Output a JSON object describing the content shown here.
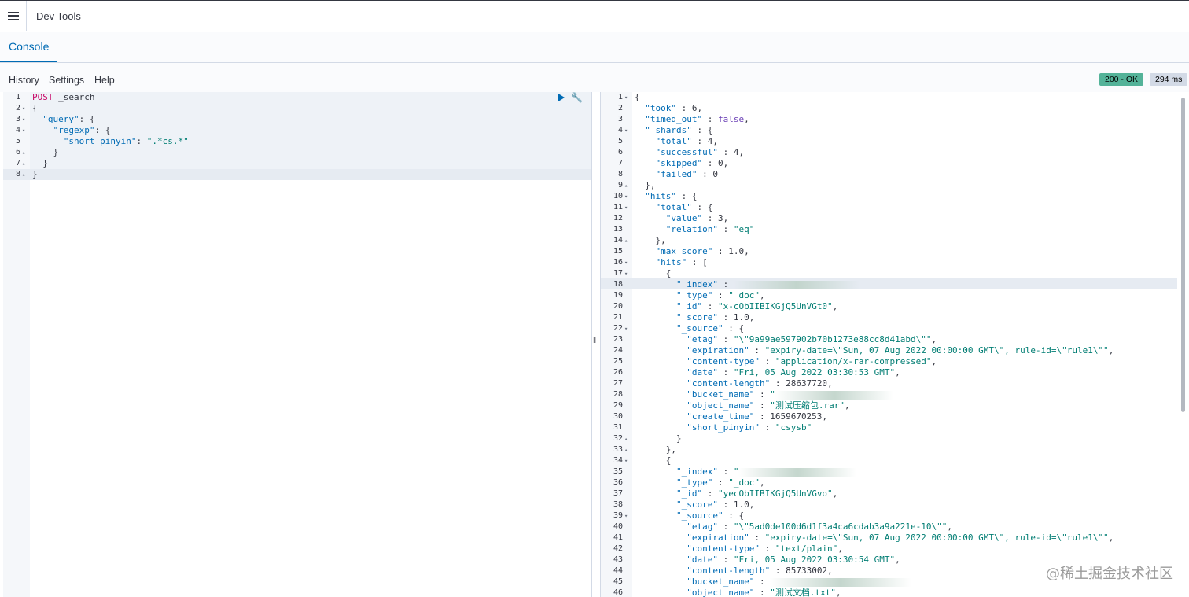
{
  "header": {
    "title": "Dev Tools"
  },
  "tabs": [
    {
      "label": "Console"
    }
  ],
  "toolbar": {
    "history": "History",
    "settings": "Settings",
    "help": "Help"
  },
  "status": {
    "code": "200 - OK",
    "time": "294 ms"
  },
  "request": {
    "lines": [
      {
        "num": "1",
        "fold": "",
        "parts": [
          [
            "method",
            "POST"
          ],
          [
            "url",
            " _search"
          ]
        ]
      },
      {
        "num": "2",
        "fold": "▾",
        "parts": [
          [
            "plain",
            "{"
          ]
        ]
      },
      {
        "num": "3",
        "fold": "▾",
        "parts": [
          [
            "plain",
            "  "
          ],
          [
            "key",
            "\"query\""
          ],
          [
            "plain",
            ": {"
          ]
        ]
      },
      {
        "num": "4",
        "fold": "▾",
        "parts": [
          [
            "plain",
            "    "
          ],
          [
            "key",
            "\"regexp\""
          ],
          [
            "plain",
            ": {"
          ]
        ]
      },
      {
        "num": "5",
        "fold": "",
        "parts": [
          [
            "plain",
            "      "
          ],
          [
            "key",
            "\"short_pinyin\""
          ],
          [
            "plain",
            ": "
          ],
          [
            "str",
            "\".*cs.*\""
          ]
        ]
      },
      {
        "num": "6",
        "fold": "▴",
        "parts": [
          [
            "plain",
            "    }"
          ]
        ]
      },
      {
        "num": "7",
        "fold": "▴",
        "parts": [
          [
            "plain",
            "  }"
          ]
        ]
      },
      {
        "num": "8",
        "fold": "▴",
        "parts": [
          [
            "plain",
            "}"
          ]
        ]
      }
    ]
  },
  "response": {
    "lines": [
      {
        "num": "1",
        "fold": "▾",
        "parts": [
          [
            "plain",
            "{"
          ]
        ]
      },
      {
        "num": "2",
        "fold": "",
        "parts": [
          [
            "plain",
            "  "
          ],
          [
            "key",
            "\"took\""
          ],
          [
            "plain",
            " : "
          ],
          [
            "num",
            "6"
          ],
          [
            "plain",
            ","
          ]
        ]
      },
      {
        "num": "3",
        "fold": "",
        "parts": [
          [
            "plain",
            "  "
          ],
          [
            "key",
            "\"timed_out\""
          ],
          [
            "plain",
            " : "
          ],
          [
            "bool",
            "false"
          ],
          [
            "plain",
            ","
          ]
        ]
      },
      {
        "num": "4",
        "fold": "▾",
        "parts": [
          [
            "plain",
            "  "
          ],
          [
            "key",
            "\"_shards\""
          ],
          [
            "plain",
            " : {"
          ]
        ]
      },
      {
        "num": "5",
        "fold": "",
        "parts": [
          [
            "plain",
            "    "
          ],
          [
            "key",
            "\"total\""
          ],
          [
            "plain",
            " : "
          ],
          [
            "num",
            "4"
          ],
          [
            "plain",
            ","
          ]
        ]
      },
      {
        "num": "6",
        "fold": "",
        "parts": [
          [
            "plain",
            "    "
          ],
          [
            "key",
            "\"successful\""
          ],
          [
            "plain",
            " : "
          ],
          [
            "num",
            "4"
          ],
          [
            "plain",
            ","
          ]
        ]
      },
      {
        "num": "7",
        "fold": "",
        "parts": [
          [
            "plain",
            "    "
          ],
          [
            "key",
            "\"skipped\""
          ],
          [
            "plain",
            " : "
          ],
          [
            "num",
            "0"
          ],
          [
            "plain",
            ","
          ]
        ]
      },
      {
        "num": "8",
        "fold": "",
        "parts": [
          [
            "plain",
            "    "
          ],
          [
            "key",
            "\"failed\""
          ],
          [
            "plain",
            " : "
          ],
          [
            "num",
            "0"
          ]
        ]
      },
      {
        "num": "9",
        "fold": "▴",
        "parts": [
          [
            "plain",
            "  },"
          ]
        ]
      },
      {
        "num": "10",
        "fold": "▾",
        "parts": [
          [
            "plain",
            "  "
          ],
          [
            "key",
            "\"hits\""
          ],
          [
            "plain",
            " : {"
          ]
        ]
      },
      {
        "num": "11",
        "fold": "▾",
        "parts": [
          [
            "plain",
            "    "
          ],
          [
            "key",
            "\"total\""
          ],
          [
            "plain",
            " : {"
          ]
        ]
      },
      {
        "num": "12",
        "fold": "",
        "parts": [
          [
            "plain",
            "      "
          ],
          [
            "key",
            "\"value\""
          ],
          [
            "plain",
            " : "
          ],
          [
            "num",
            "3"
          ],
          [
            "plain",
            ","
          ]
        ]
      },
      {
        "num": "13",
        "fold": "",
        "parts": [
          [
            "plain",
            "      "
          ],
          [
            "key",
            "\"relation\""
          ],
          [
            "plain",
            " : "
          ],
          [
            "str",
            "\"eq\""
          ]
        ]
      },
      {
        "num": "14",
        "fold": "▴",
        "parts": [
          [
            "plain",
            "    },"
          ]
        ]
      },
      {
        "num": "15",
        "fold": "",
        "parts": [
          [
            "plain",
            "    "
          ],
          [
            "key",
            "\"max_score\""
          ],
          [
            "plain",
            " : "
          ],
          [
            "num",
            "1.0"
          ],
          [
            "plain",
            ","
          ]
        ]
      },
      {
        "num": "16",
        "fold": "▾",
        "parts": [
          [
            "plain",
            "    "
          ],
          [
            "key",
            "\"hits\""
          ],
          [
            "plain",
            " : ["
          ]
        ]
      },
      {
        "num": "17",
        "fold": "▾",
        "parts": [
          [
            "plain",
            "      {"
          ]
        ]
      },
      {
        "num": "18",
        "fold": "",
        "parts": [
          [
            "plain",
            "        "
          ],
          [
            "key",
            "\"_index\""
          ],
          [
            "plain",
            " : "
          ],
          [
            "blur",
            "160"
          ]
        ]
      },
      {
        "num": "19",
        "fold": "",
        "parts": [
          [
            "plain",
            "        "
          ],
          [
            "key",
            "\"_type\""
          ],
          [
            "plain",
            " : "
          ],
          [
            "str",
            "\"_doc\""
          ],
          [
            "plain",
            ","
          ]
        ]
      },
      {
        "num": "20",
        "fold": "",
        "parts": [
          [
            "plain",
            "        "
          ],
          [
            "key",
            "\"_id\""
          ],
          [
            "plain",
            " : "
          ],
          [
            "str",
            "\"x-cObIIBIKGjQ5UnVGt0\""
          ],
          [
            "plain",
            ","
          ]
        ]
      },
      {
        "num": "21",
        "fold": "",
        "parts": [
          [
            "plain",
            "        "
          ],
          [
            "key",
            "\"_score\""
          ],
          [
            "plain",
            " : "
          ],
          [
            "num",
            "1.0"
          ],
          [
            "plain",
            ","
          ]
        ]
      },
      {
        "num": "22",
        "fold": "▾",
        "parts": [
          [
            "plain",
            "        "
          ],
          [
            "key",
            "\"_source\""
          ],
          [
            "plain",
            " : {"
          ]
        ]
      },
      {
        "num": "23",
        "fold": "",
        "parts": [
          [
            "plain",
            "          "
          ],
          [
            "key",
            "\"etag\""
          ],
          [
            "plain",
            " : "
          ],
          [
            "str",
            "\"\\\"9a99ae597902b70b1273e88cc8d41abd\\\"\""
          ],
          [
            "plain",
            ","
          ]
        ]
      },
      {
        "num": "24",
        "fold": "",
        "parts": [
          [
            "plain",
            "          "
          ],
          [
            "key",
            "\"expiration\""
          ],
          [
            "plain",
            " : "
          ],
          [
            "str",
            "\"expiry-date=\\\"Sun, 07 Aug 2022 00:00:00 GMT\\\", rule-id=\\\"rule1\\\"\""
          ],
          [
            "plain",
            ","
          ]
        ]
      },
      {
        "num": "25",
        "fold": "",
        "parts": [
          [
            "plain",
            "          "
          ],
          [
            "key",
            "\"content-type\""
          ],
          [
            "plain",
            " : "
          ],
          [
            "str",
            "\"application/x-rar-compressed\""
          ],
          [
            "plain",
            ","
          ]
        ]
      },
      {
        "num": "26",
        "fold": "",
        "parts": [
          [
            "plain",
            "          "
          ],
          [
            "key",
            "\"date\""
          ],
          [
            "plain",
            " : "
          ],
          [
            "str",
            "\"Fri, 05 Aug 2022 03:30:53 GMT\""
          ],
          [
            "plain",
            ","
          ]
        ]
      },
      {
        "num": "27",
        "fold": "",
        "parts": [
          [
            "plain",
            "          "
          ],
          [
            "key",
            "\"content-length\""
          ],
          [
            "plain",
            " : "
          ],
          [
            "num",
            "28637720"
          ],
          [
            "plain",
            ","
          ]
        ]
      },
      {
        "num": "28",
        "fold": "",
        "parts": [
          [
            "plain",
            "          "
          ],
          [
            "key",
            "\"bucket_name\""
          ],
          [
            "plain",
            " : "
          ],
          [
            "str",
            "\""
          ],
          [
            "blur",
            "150"
          ]
        ]
      },
      {
        "num": "29",
        "fold": "",
        "parts": [
          [
            "plain",
            "          "
          ],
          [
            "key",
            "\"object_name\""
          ],
          [
            "plain",
            " : "
          ],
          [
            "str",
            "\"测试压缩包.rar\""
          ],
          [
            "plain",
            ","
          ]
        ]
      },
      {
        "num": "30",
        "fold": "",
        "parts": [
          [
            "plain",
            "          "
          ],
          [
            "key",
            "\"create_time\""
          ],
          [
            "plain",
            " : "
          ],
          [
            "num",
            "1659670253"
          ],
          [
            "plain",
            ","
          ]
        ]
      },
      {
        "num": "31",
        "fold": "",
        "parts": [
          [
            "plain",
            "          "
          ],
          [
            "key",
            "\"short_pinyin\""
          ],
          [
            "plain",
            " : "
          ],
          [
            "str",
            "\"csysb\""
          ]
        ]
      },
      {
        "num": "32",
        "fold": "▴",
        "parts": [
          [
            "plain",
            "        }"
          ]
        ]
      },
      {
        "num": "33",
        "fold": "▴",
        "parts": [
          [
            "plain",
            "      },"
          ]
        ]
      },
      {
        "num": "34",
        "fold": "▾",
        "parts": [
          [
            "plain",
            "      {"
          ]
        ]
      },
      {
        "num": "35",
        "fold": "",
        "parts": [
          [
            "plain",
            "        "
          ],
          [
            "key",
            "\"_index\""
          ],
          [
            "plain",
            " : "
          ],
          [
            "str",
            "\""
          ],
          [
            "blur",
            "150"
          ]
        ]
      },
      {
        "num": "36",
        "fold": "",
        "parts": [
          [
            "plain",
            "        "
          ],
          [
            "key",
            "\"_type\""
          ],
          [
            "plain",
            " : "
          ],
          [
            "str",
            "\"_doc\""
          ],
          [
            "plain",
            ","
          ]
        ]
      },
      {
        "num": "37",
        "fold": "",
        "parts": [
          [
            "plain",
            "        "
          ],
          [
            "key",
            "\"_id\""
          ],
          [
            "plain",
            " : "
          ],
          [
            "str",
            "\"yecObIIBIKGjQ5UnVGvo\""
          ],
          [
            "plain",
            ","
          ]
        ]
      },
      {
        "num": "38",
        "fold": "",
        "parts": [
          [
            "plain",
            "        "
          ],
          [
            "key",
            "\"_score\""
          ],
          [
            "plain",
            " : "
          ],
          [
            "num",
            "1.0"
          ],
          [
            "plain",
            ","
          ]
        ]
      },
      {
        "num": "39",
        "fold": "▾",
        "parts": [
          [
            "plain",
            "        "
          ],
          [
            "key",
            "\"_source\""
          ],
          [
            "plain",
            " : {"
          ]
        ]
      },
      {
        "num": "40",
        "fold": "",
        "parts": [
          [
            "plain",
            "          "
          ],
          [
            "key",
            "\"etag\""
          ],
          [
            "plain",
            " : "
          ],
          [
            "str",
            "\"\\\"5ad0de100d6d1f3a4ca6cdab3a9a221e-10\\\"\""
          ],
          [
            "plain",
            ","
          ]
        ]
      },
      {
        "num": "41",
        "fold": "",
        "parts": [
          [
            "plain",
            "          "
          ],
          [
            "key",
            "\"expiration\""
          ],
          [
            "plain",
            " : "
          ],
          [
            "str",
            "\"expiry-date=\\\"Sun, 07 Aug 2022 00:00:00 GMT\\\", rule-id=\\\"rule1\\\"\""
          ],
          [
            "plain",
            ","
          ]
        ]
      },
      {
        "num": "42",
        "fold": "",
        "parts": [
          [
            "plain",
            "          "
          ],
          [
            "key",
            "\"content-type\""
          ],
          [
            "plain",
            " : "
          ],
          [
            "str",
            "\"text/plain\""
          ],
          [
            "plain",
            ","
          ]
        ]
      },
      {
        "num": "43",
        "fold": "",
        "parts": [
          [
            "plain",
            "          "
          ],
          [
            "key",
            "\"date\""
          ],
          [
            "plain",
            " : "
          ],
          [
            "str",
            "\"Fri, 05 Aug 2022 03:30:54 GMT\""
          ],
          [
            "plain",
            ","
          ]
        ]
      },
      {
        "num": "44",
        "fold": "",
        "parts": [
          [
            "plain",
            "          "
          ],
          [
            "key",
            "\"content-length\""
          ],
          [
            "plain",
            " : "
          ],
          [
            "num",
            "85733002"
          ],
          [
            "plain",
            ","
          ]
        ]
      },
      {
        "num": "45",
        "fold": "",
        "parts": [
          [
            "plain",
            "          "
          ],
          [
            "key",
            "\"bucket_name\""
          ],
          [
            "plain",
            " : "
          ],
          [
            "blur",
            "180"
          ]
        ]
      },
      {
        "num": "46",
        "fold": "",
        "parts": [
          [
            "plain",
            "          "
          ],
          [
            "key",
            "\"object_name\""
          ],
          [
            "plain",
            " : "
          ],
          [
            "str",
            "\"测试文档.txt\""
          ],
          [
            "plain",
            ","
          ]
        ]
      }
    ]
  },
  "watermark": "@稀土掘金技术社区",
  "icons": {
    "menu": "hamburger-icon",
    "send": "play-icon",
    "wrench": "wrench-icon"
  }
}
